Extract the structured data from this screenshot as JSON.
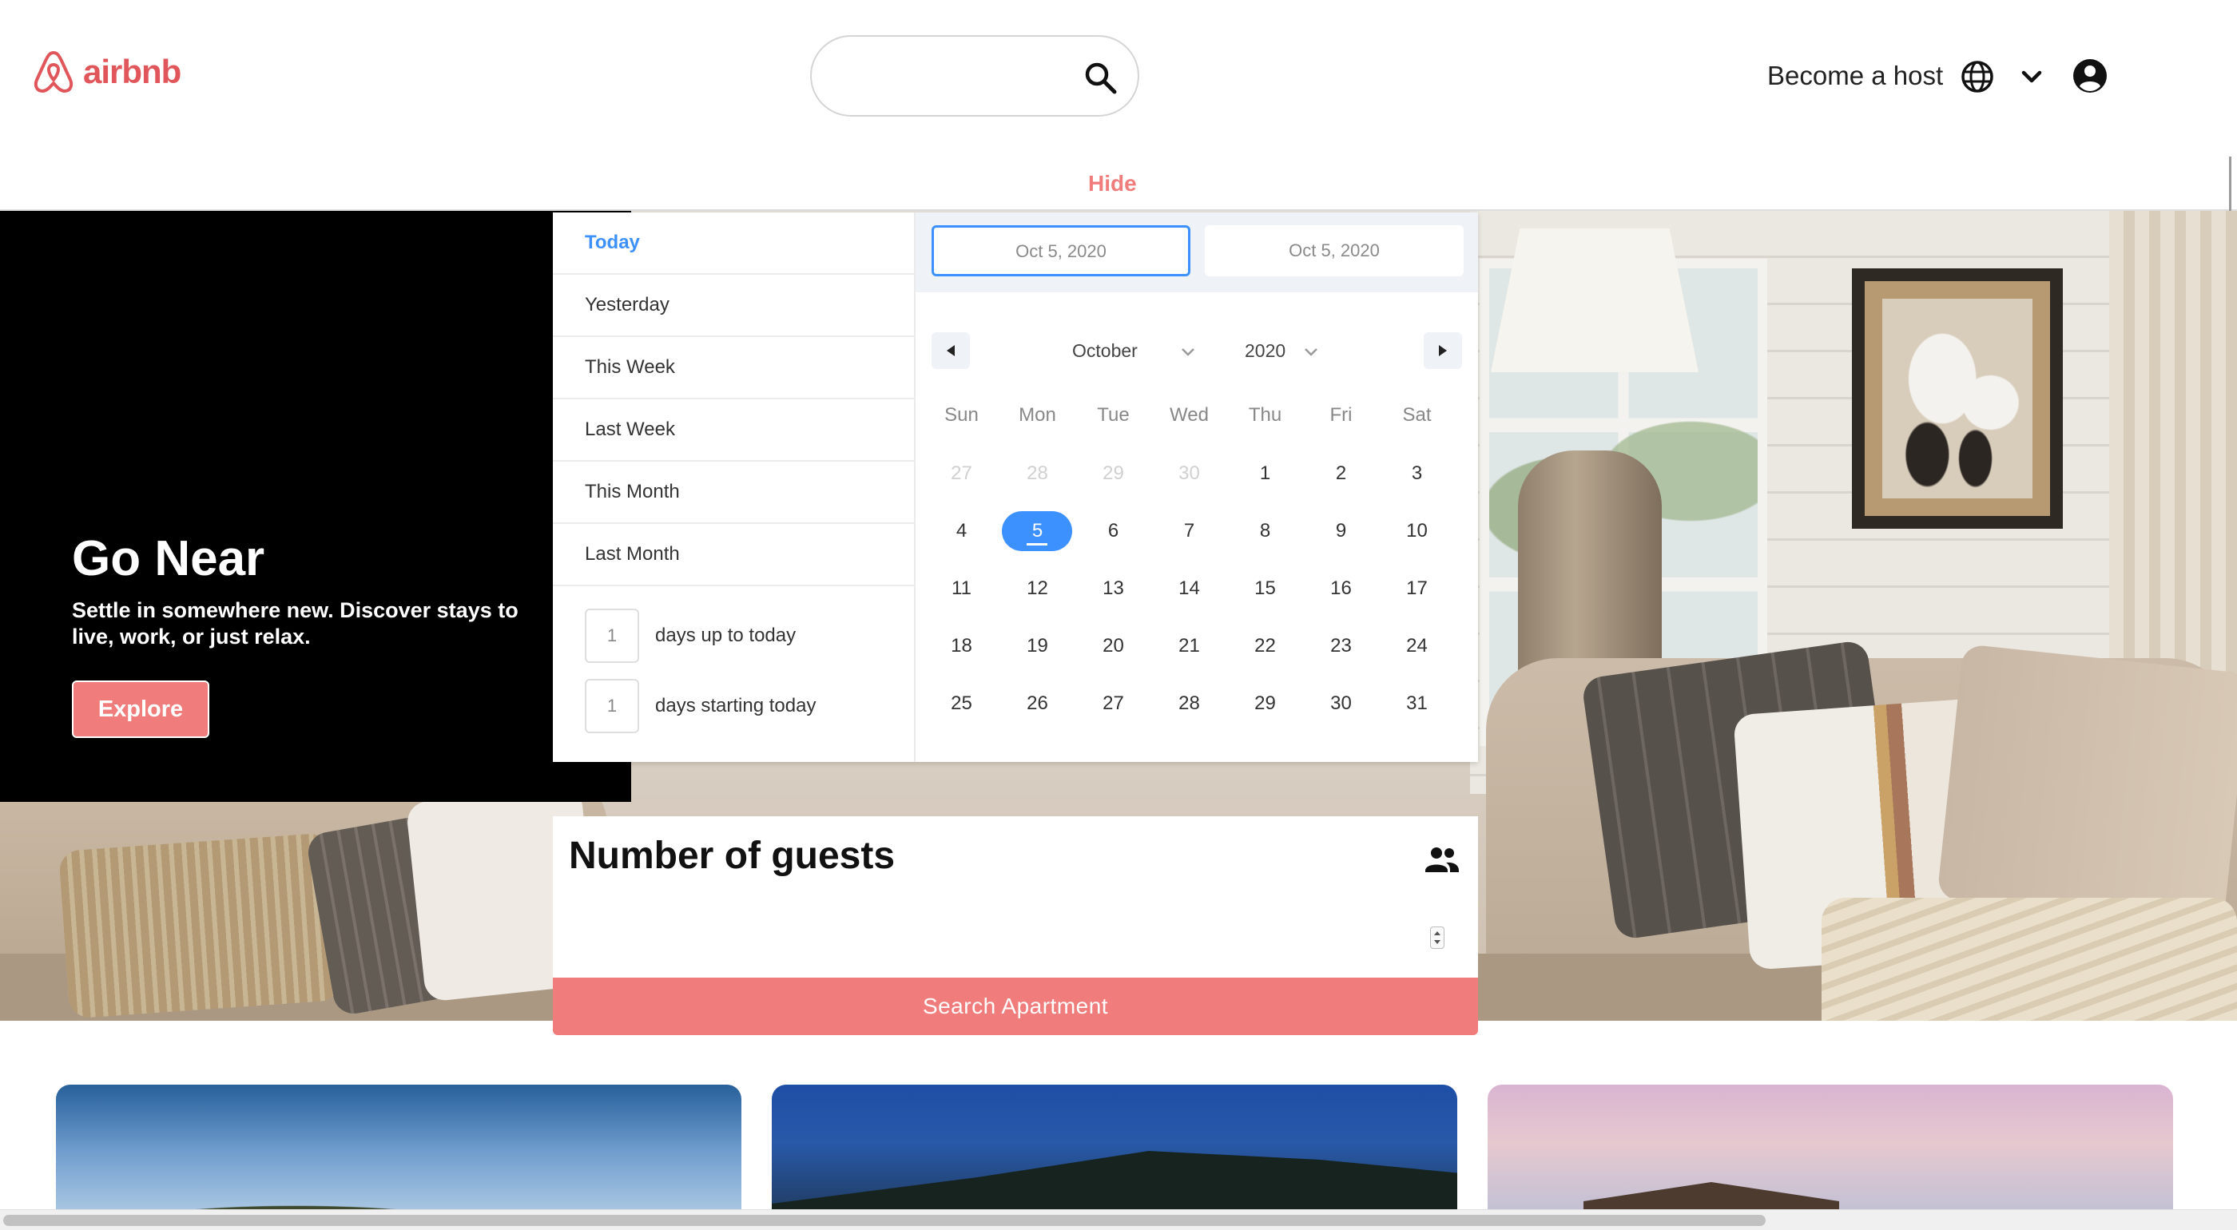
{
  "header": {
    "logo_text": "airbnb",
    "host_label": "Become a host",
    "hide_label": "Hide"
  },
  "search": {
    "value": "",
    "placeholder": ""
  },
  "promo": {
    "title": "Go Near",
    "subtitle": "Settle in somewhere new. Discover stays to live, work, or just relax.",
    "button_label": "Explore"
  },
  "date_picker": {
    "ranges": [
      "Today",
      "Yesterday",
      "This Week",
      "Last Week",
      "This Month",
      "Last Month"
    ],
    "active_range": "Today",
    "input_ranges": [
      {
        "value": "1",
        "label": "days up to today"
      },
      {
        "value": "1",
        "label": "days starting today"
      }
    ],
    "start_date": "Oct 5, 2020",
    "end_date": "Oct 5, 2020",
    "month": "October",
    "year": "2020",
    "weekdays": [
      "Sun",
      "Mon",
      "Tue",
      "Wed",
      "Thu",
      "Fri",
      "Sat"
    ],
    "weeks": [
      [
        "27",
        "28",
        "29",
        "30",
        "1",
        "2",
        "3"
      ],
      [
        "4",
        "5",
        "6",
        "7",
        "8",
        "9",
        "10"
      ],
      [
        "11",
        "12",
        "13",
        "14",
        "15",
        "16",
        "17"
      ],
      [
        "18",
        "19",
        "20",
        "21",
        "22",
        "23",
        "24"
      ],
      [
        "25",
        "26",
        "27",
        "28",
        "29",
        "30",
        "31"
      ]
    ],
    "passive_days": [
      "27",
      "28",
      "29",
      "30"
    ],
    "selected_day": "5",
    "accent_color": "#3d91ff"
  },
  "guests": {
    "title": "Number of guests",
    "value": ""
  },
  "search_button_label": "Search Apartment",
  "colors": {
    "brand": "#e0565b",
    "button": "#f07d7c"
  },
  "icons": [
    "airbnb-logo-icon",
    "search-icon",
    "globe-icon",
    "chevron-down-icon",
    "account-circle-icon",
    "arrow-left-icon",
    "arrow-right-icon",
    "people-icon"
  ]
}
